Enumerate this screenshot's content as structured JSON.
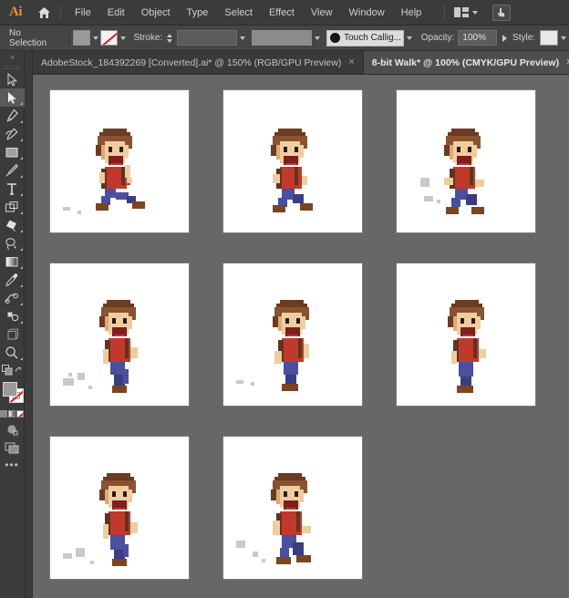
{
  "app": {
    "name": "Ai",
    "logo_color": "#e8913c"
  },
  "menubar": {
    "home_icon": "home-icon",
    "items": [
      "File",
      "Edit",
      "Object",
      "Type",
      "Select",
      "Effect",
      "View",
      "Window",
      "Help"
    ],
    "arrange_icon": "arrange-documents-icon",
    "arrange_chevron": "chevron-down-icon",
    "touch_workspace_icon": "touch-workspace-icon"
  },
  "controlbar": {
    "selection_status": "No Selection",
    "fill_label": "fill-swatch",
    "fill_color": "#9a9a9a",
    "stroke_swatch_label": "stroke-swatch-none",
    "stroke_label": "Stroke:",
    "stroke_weight_value": "",
    "stroke_profile_value": "",
    "brush_name": "Touch Callig...",
    "brush_dot_color": "#151515",
    "opacity_label": "Opacity:",
    "opacity_value": "100%",
    "style_label": "Style:",
    "style_swatch_color": "#e8e8e8"
  },
  "tabs": [
    {
      "title": "AdobeStock_184392269 [Converted].ai* @ 150% (RGB/GPU Preview)",
      "close": "×",
      "active": false
    },
    {
      "title": "8-bit Walk* @ 100% (CMYK/GPU Preview)",
      "close": "×",
      "active": true
    }
  ],
  "toolbar": {
    "expand_icon": "double-chevron-right-icon",
    "tools": [
      {
        "name": "selection-tool",
        "icon": "arrow-outline-icon",
        "selected": false,
        "has_flyout": false
      },
      {
        "name": "direct-selection-tool",
        "icon": "arrow-solid-icon",
        "selected": true,
        "has_flyout": true
      },
      {
        "name": "pen-tool",
        "icon": "pen-icon",
        "selected": false,
        "has_flyout": true
      },
      {
        "name": "curvature-tool",
        "icon": "curvature-pen-icon",
        "selected": false,
        "has_flyout": true
      },
      {
        "name": "rectangle-tool",
        "icon": "rectangle-icon",
        "selected": false,
        "has_flyout": true
      },
      {
        "name": "paintbrush-tool",
        "icon": "paintbrush-icon",
        "selected": false,
        "has_flyout": true
      },
      {
        "name": "type-tool",
        "icon": "type-t-icon",
        "selected": false,
        "has_flyout": true
      },
      {
        "name": "free-transform-tool",
        "icon": "free-transform-icon",
        "selected": false,
        "has_flyout": true
      },
      {
        "name": "shape-builder-tool",
        "icon": "shape-builder-icon",
        "selected": false,
        "has_flyout": true
      },
      {
        "name": "lasso-tool",
        "icon": "lasso-icon",
        "selected": false,
        "has_flyout": true
      },
      {
        "name": "gradient-tool",
        "icon": "gradient-icon",
        "selected": false,
        "has_flyout": true
      },
      {
        "name": "eyedropper-tool",
        "icon": "eyedropper-icon",
        "selected": false,
        "has_flyout": true
      },
      {
        "name": "blend-tool",
        "icon": "blend-icon",
        "selected": false,
        "has_flyout": true
      },
      {
        "name": "symbol-sprayer-tool",
        "icon": "symbol-sprayer-icon",
        "selected": false,
        "has_flyout": true
      },
      {
        "name": "artboard-tool",
        "icon": "artboard-icon",
        "selected": false,
        "has_flyout": false
      },
      {
        "name": "zoom-tool",
        "icon": "magnifier-icon",
        "selected": false,
        "has_flyout": true
      }
    ],
    "swap_icon": "swap-fill-stroke-icon",
    "fill_color": "#9a9a9a",
    "stroke_color": "#ffffff",
    "stroke_is_none": true,
    "color_modes": [
      "color-swatch-mode",
      "gradient-mode",
      "none-mode"
    ],
    "draw_mode_icon": "draw-normal-icon",
    "screen_mode_icon": "change-screen-mode-icon",
    "more_tools_icon": "ellipsis-icon"
  },
  "canvas": {
    "background_color": "#676767",
    "artboard_color": "#ffffff",
    "artboards": [
      {
        "name": "artboard-1",
        "frame": 1,
        "pose": "stride-back",
        "dust": "left-small"
      },
      {
        "name": "artboard-2",
        "frame": 2,
        "pose": "stride-mid",
        "dust": "none"
      },
      {
        "name": "artboard-3",
        "frame": 3,
        "pose": "stride-fwd",
        "dust": "under-foot"
      },
      {
        "name": "artboard-4",
        "frame": 4,
        "pose": "step-up",
        "dust": "left-puff"
      },
      {
        "name": "artboard-5",
        "frame": 5,
        "pose": "step-lift",
        "dust": "left-small"
      },
      {
        "name": "artboard-6",
        "frame": 6,
        "pose": "stand",
        "dust": "none"
      },
      {
        "name": "artboard-7",
        "frame": 7,
        "pose": "step-down",
        "dust": "left-puff"
      },
      {
        "name": "artboard-8",
        "frame": 8,
        "pose": "stride-open",
        "dust": "left-puff"
      }
    ]
  },
  "palette": {
    "hair_dark": "#6b3b22",
    "hair_mid": "#8a5230",
    "skin": "#f0cda0",
    "skin_shadow": "#d9ab78",
    "shirt": "#c0392b",
    "shirt_dark": "#8c2b20",
    "strap": "#5e3520",
    "pants": "#4a4fa0",
    "pants_dark": "#3a3d80",
    "shoe": "#7a4520",
    "mouth": "#7d1f1f",
    "eye": "#2b1a10",
    "dust": "#c9c9c9"
  }
}
